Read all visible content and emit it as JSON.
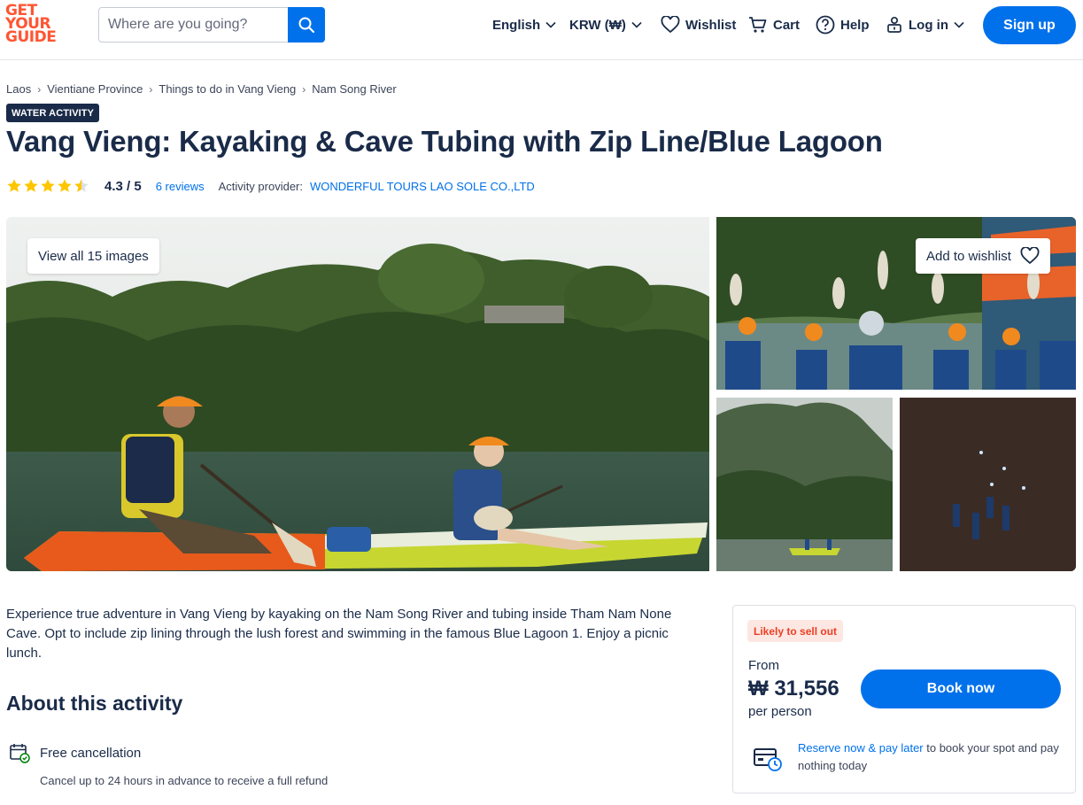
{
  "brand": {
    "logo_lines": [
      "GET",
      "YOUR",
      "GUIDE"
    ],
    "accent": "#ff5533",
    "primary": "#0071eb"
  },
  "search": {
    "placeholder": "Where are you going?"
  },
  "nav": {
    "language": "English",
    "currency": "KRW (₩)",
    "wishlist": "Wishlist",
    "cart": "Cart",
    "help": "Help",
    "login": "Log in",
    "signup": "Sign up"
  },
  "breadcrumb": [
    "Laos",
    "Vientiane Province",
    "Things to do in Vang Vieng",
    "Nam Song River"
  ],
  "badge": "WATER ACTIVITY",
  "title": "Vang Vieng: Kayaking & Cave Tubing with Zip Line/Blue Lagoon",
  "rating": {
    "value": "4.3",
    "separator": "/",
    "max": "5",
    "stars_score": 4.3,
    "reviews": "6 reviews",
    "provider_label": "Activity provider:",
    "provider": "WONDERFUL TOURS LAO SOLE CO.,LTD"
  },
  "gallery": {
    "view_all": "View all 15 images",
    "add_wishlist": "Add to wishlist"
  },
  "description": "Experience true adventure in Vang Vieng by kayaking on the Nam Song River and tubing inside Tham Nam None Cave. Opt to include zip lining through the lush forest and swimming in the famous Blue Lagoon 1. Enjoy a picnic lunch.",
  "about": {
    "title": "About this activity",
    "features": [
      {
        "title": "Free cancellation",
        "subtitle": "Cancel up to 24 hours in advance to receive a full refund",
        "icon": "calendar-check-icon"
      }
    ]
  },
  "booking": {
    "sellout_badge": "Likely to sell out",
    "from_label": "From",
    "price": "₩ 31,556",
    "per_person": "per person",
    "book_button": "Book now",
    "reserve_link": "Reserve now & pay later",
    "reserve_text": " to book your spot and pay nothing today"
  }
}
